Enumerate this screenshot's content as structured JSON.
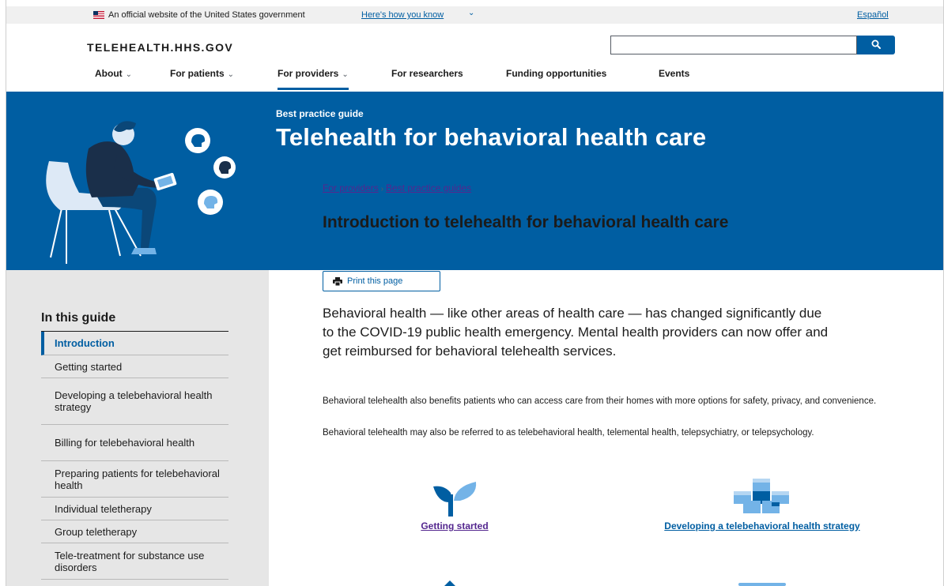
{
  "gov_banner": {
    "official_text": "An official website of the United States government",
    "how_you_know": "Here's how you know",
    "language_link": "Español"
  },
  "header": {
    "site_title": "TELEHEALTH.HHS.GOV",
    "search": {
      "value": "",
      "placeholder": ""
    }
  },
  "nav": [
    {
      "label": "About",
      "has_dropdown": true
    },
    {
      "label": "For patients",
      "has_dropdown": true
    },
    {
      "label": "For providers",
      "has_dropdown": true,
      "active": true
    },
    {
      "label": "For researchers",
      "has_dropdown": false
    },
    {
      "label": "Funding opportunities",
      "has_dropdown": false
    },
    {
      "label": "Events",
      "has_dropdown": false
    }
  ],
  "hero": {
    "eyebrow": "Best practice guide",
    "title": "Telehealth for behavioral health care"
  },
  "sidebar": {
    "title": "In this guide",
    "items": [
      {
        "label": "Introduction",
        "current": true
      },
      {
        "label": "Getting started"
      },
      {
        "label": "Developing a telebehavioral health strategy"
      },
      {
        "label": "Billing for telebehavioral health"
      },
      {
        "label": "Preparing patients for telebehavioral health"
      },
      {
        "label": "Individual teletherapy"
      },
      {
        "label": "Group teletherapy"
      },
      {
        "label": "Tele-treatment for substance use disorders"
      }
    ]
  },
  "main": {
    "breadcrumb": [
      "For providers",
      "Best practice guides"
    ],
    "breadcrumb_separator": "›",
    "heading": "Introduction to telehealth for behavioral health care",
    "print_label": "Print this page",
    "lead": "Behavioral health — like other areas of health care — has changed significantly due to the COVID-19 public health emergency. Mental health providers can now offer and get reimbursed for behavioral telehealth services.",
    "paragraphs": [
      "Behavioral telehealth also benefits patients who can access care from their homes with more options for safety, privacy, and convenience.",
      "Behavioral telehealth may also be referred to as telebehavioral health, telemental health, telepsychiatry, or telepsychology."
    ],
    "cards": [
      {
        "label": "Getting started",
        "icon": "sprout-icon"
      },
      {
        "label": "Developing a telebehavioral health strategy",
        "icon": "building-blocks-icon"
      }
    ]
  },
  "colors": {
    "primary_blue": "#005ea2",
    "visited_link": "#54278f",
    "sidebar_bg": "#e6e6e6",
    "banner_bg": "#f0f0f0",
    "icon_light_blue": "#73b3e7"
  }
}
